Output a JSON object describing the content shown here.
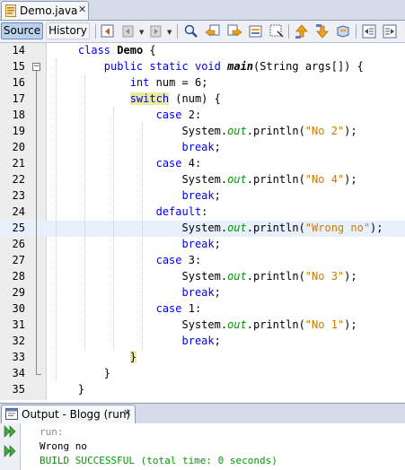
{
  "editor_tab": {
    "file_name": "Demo.java",
    "close_glyph": "✕"
  },
  "toolbar": {
    "source_label": "Source",
    "history_label": "History",
    "icons": [
      "last-edit-icon",
      "back-icon",
      "forward-icon",
      "find-icon",
      "find-previous-icon",
      "find-next-icon",
      "find-selection-icon",
      "toggle-highlight-icon",
      "previous-bookmark-icon",
      "next-bookmark-icon",
      "toggle-bookmark-icon",
      "shift-left-icon",
      "shift-right-icon"
    ]
  },
  "code": {
    "lines": [
      {
        "num": "14",
        "text": "    class Demo {"
      },
      {
        "num": "15",
        "text": "        public static void main(String args[]) {"
      },
      {
        "num": "16",
        "text": "            int num = 6;"
      },
      {
        "num": "17",
        "text": "            switch (num) {"
      },
      {
        "num": "18",
        "text": "                case 2:"
      },
      {
        "num": "19",
        "text": "                    System.out.println(\"No 2\");"
      },
      {
        "num": "20",
        "text": "                    break;"
      },
      {
        "num": "21",
        "text": "                case 4:"
      },
      {
        "num": "22",
        "text": "                    System.out.println(\"No 4\");"
      },
      {
        "num": "23",
        "text": "                    break;"
      },
      {
        "num": "24",
        "text": "                default:"
      },
      {
        "num": "25",
        "text": "                    System.out.println(\"Wrong no\");"
      },
      {
        "num": "26",
        "text": "                    break;"
      },
      {
        "num": "27",
        "text": "                case 3:"
      },
      {
        "num": "28",
        "text": "                    System.out.println(\"No 3\");"
      },
      {
        "num": "29",
        "text": "                    break;"
      },
      {
        "num": "30",
        "text": "                case 1:"
      },
      {
        "num": "31",
        "text": "                    System.out.println(\"No 1\");"
      },
      {
        "num": "32",
        "text": "                    break;"
      },
      {
        "num": "33",
        "text": "            }"
      },
      {
        "num": "34",
        "text": "        }"
      },
      {
        "num": "35",
        "text": "    }"
      }
    ],
    "current_line": "25",
    "colors": {
      "keyword": "#0000e6",
      "string": "#ce7b00",
      "static_field": "#009900",
      "bracket_match": "#ebeb9c",
      "current_line_bg": "#e8f0fb"
    }
  },
  "output": {
    "tab_label": "Output - Blogg (run)",
    "close_glyph": "✕",
    "lines": [
      {
        "text": "run:",
        "style": "gray"
      },
      {
        "text": "Wrong no",
        "style": "black"
      },
      {
        "text": "BUILD SUCCESSFUL (total time: 0 seconds)",
        "style": "green"
      }
    ]
  }
}
